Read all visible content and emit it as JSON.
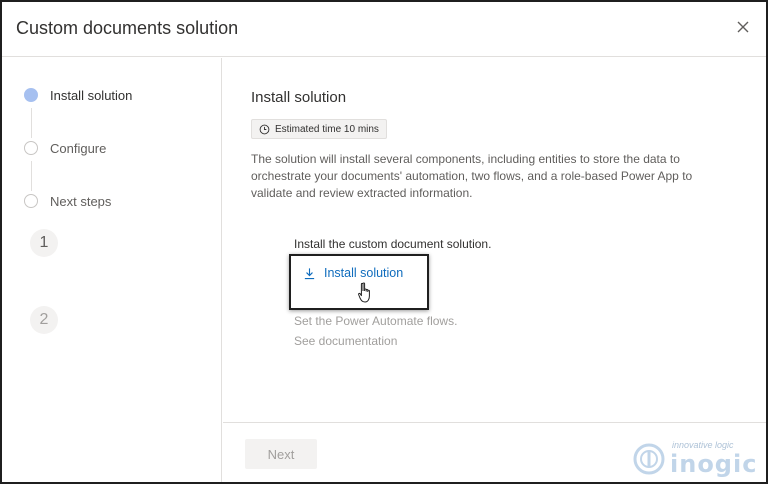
{
  "dialog": {
    "title": "Custom documents solution"
  },
  "sidebar": {
    "steps": [
      {
        "label": "Install solution",
        "active": true
      },
      {
        "label": "Configure",
        "active": false
      },
      {
        "label": "Next steps",
        "active": false
      }
    ]
  },
  "main": {
    "title": "Install solution",
    "estimated_time": "Estimated time 10 mins",
    "description": "The solution will install several components, including entities to store the data to orchestrate your documents' automation, two flows, and a role-based Power App to validate and review extracted information.",
    "items": [
      {
        "number": "1",
        "title": "Install the custom document solution.",
        "action_label": "Install solution"
      },
      {
        "number": "2",
        "title": "Set the Power Automate flows.",
        "action_label": "See documentation"
      }
    ]
  },
  "footer": {
    "next_label": "Next"
  },
  "watermark": {
    "tagline": "innovative logic",
    "brand": "inogic"
  },
  "colors": {
    "accent": "#0f6cbd",
    "active_step": "#a6c0f0",
    "border": "#e1dfdd"
  }
}
